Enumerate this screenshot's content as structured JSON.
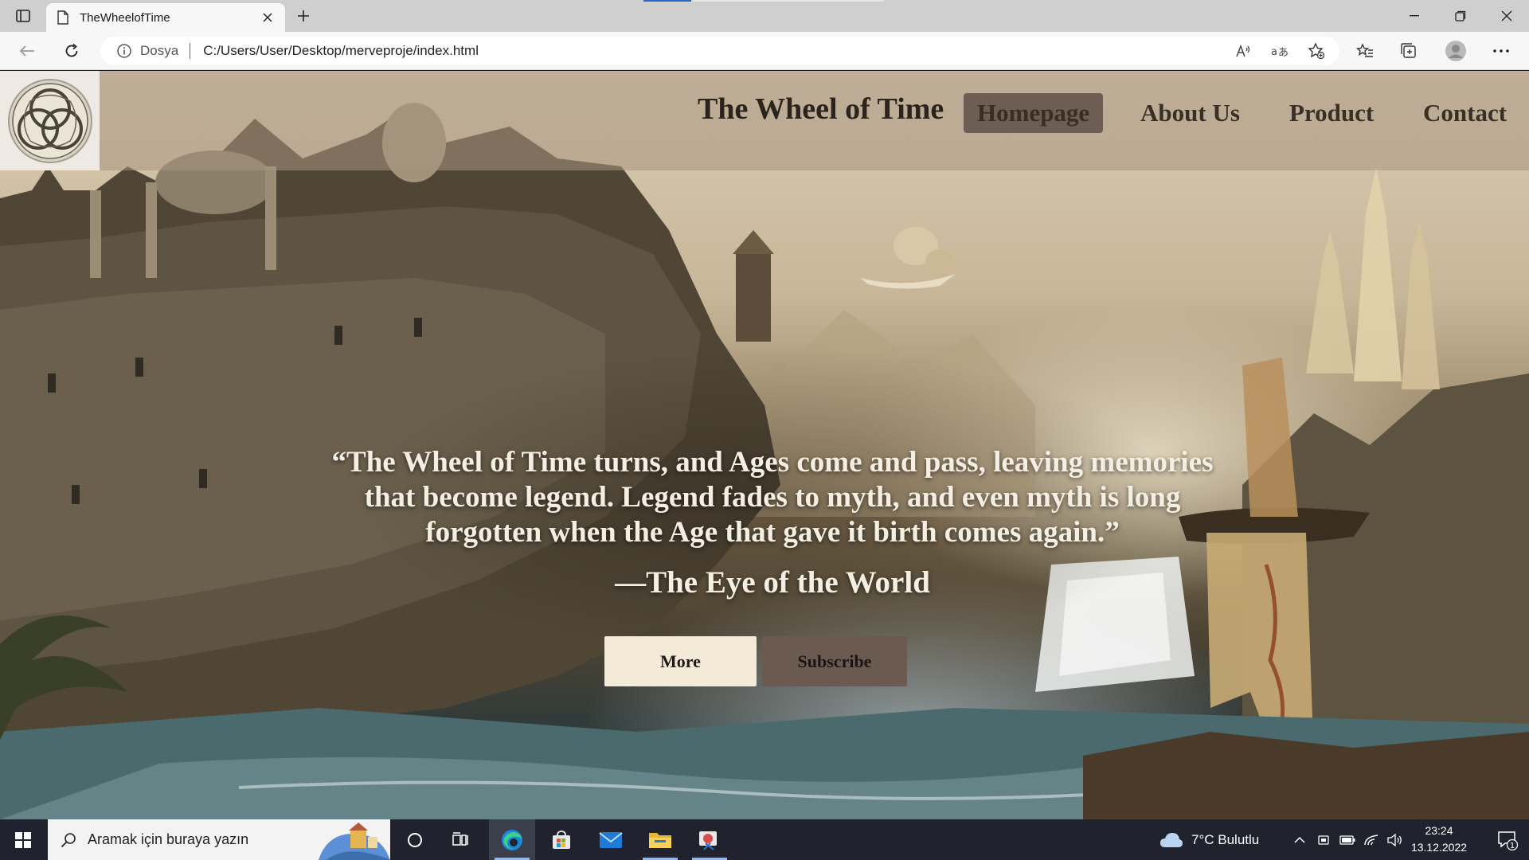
{
  "browser": {
    "tab_title": "TheWheelofTime",
    "address_scheme": "Dosya",
    "address_url": "C:/Users/User/Desktop/merveproje/index.html"
  },
  "site": {
    "brand": "The Wheel of Time",
    "nav": [
      {
        "label": "Homepage",
        "active": true
      },
      {
        "label": "About Us",
        "active": false
      },
      {
        "label": "Product",
        "active": false
      },
      {
        "label": "Contact",
        "active": false
      }
    ],
    "quote_lines": [
      "“The Wheel of Time turns, and Ages come and pass, leaving memories",
      "that become legend. Legend fades to myth, and even myth is long",
      "forgotten when the Age that gave it birth comes again.”"
    ],
    "quote_source": "—The Eye of the World",
    "buttons": {
      "more": "More",
      "subscribe": "Subscribe"
    }
  },
  "taskbar": {
    "search_placeholder": "Aramak için buraya yazın",
    "weather": "7°C Bulutlu",
    "time": "23:24",
    "date": "13.12.2022",
    "notification_count": "1"
  },
  "colors": {
    "header_overlay": "#aa9682",
    "active_nav_bg": "#6e5d52",
    "more_button_bg": "#f4ead8",
    "subscribe_button_bg": "#6b5a50",
    "taskbar_bg": "#20232e"
  }
}
